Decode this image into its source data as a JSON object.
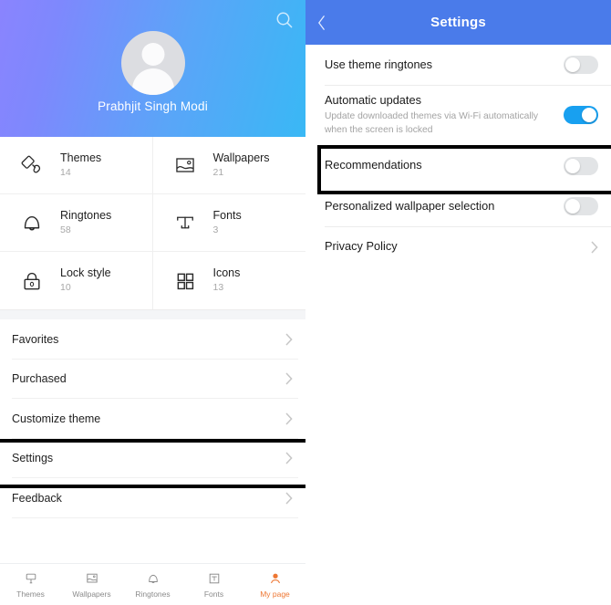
{
  "left": {
    "profile": {
      "name": "Prabhjit Singh Modi",
      "search_icon": "search-icon",
      "avatar_icon": "person-avatar-icon",
      "gradient_from": "#8a84fe",
      "gradient_to": "#39b8f5"
    },
    "grid": [
      {
        "label": "Themes",
        "count": "14",
        "icon": "paint-brush-icon"
      },
      {
        "label": "Wallpapers",
        "count": "21",
        "icon": "image-icon"
      },
      {
        "label": "Ringtones",
        "count": "58",
        "icon": "bell-icon"
      },
      {
        "label": "Fonts",
        "count": "3",
        "icon": "font-t-icon"
      },
      {
        "label": "Lock style",
        "count": "10",
        "icon": "padlock-icon"
      },
      {
        "label": "Icons",
        "count": "13",
        "icon": "grid-squares-icon"
      }
    ],
    "rows": [
      {
        "label": "Favorites",
        "chevron": "chevron-right-icon",
        "highlighted": false
      },
      {
        "label": "Purchased",
        "chevron": "chevron-right-icon",
        "highlighted": false
      },
      {
        "label": "Customize theme",
        "chevron": "chevron-right-icon",
        "highlighted": false
      },
      {
        "label": "Settings",
        "chevron": "chevron-right-icon",
        "highlighted": true
      },
      {
        "label": "Feedback",
        "chevron": "chevron-right-icon",
        "highlighted": false
      }
    ],
    "nav": {
      "active_color": "#ee7733",
      "items": [
        {
          "label": "Themes",
          "icon": "paint-brush-icon",
          "active": false
        },
        {
          "label": "Wallpapers",
          "icon": "image-icon",
          "active": false
        },
        {
          "label": "Ringtones",
          "icon": "bell-icon",
          "active": false
        },
        {
          "label": "Fonts",
          "icon": "font-t-icon",
          "active": false
        },
        {
          "label": "My page",
          "icon": "person-avatar-icon",
          "active": true
        }
      ]
    }
  },
  "right": {
    "header": {
      "title": "Settings",
      "back_icon": "chevron-left-icon",
      "bg": "#4a7bea"
    },
    "rows": [
      {
        "title": "Use theme ringtones",
        "subtitle": "",
        "control": "toggle",
        "toggle_on": false,
        "highlighted": false
      },
      {
        "title": "Automatic updates",
        "subtitle": "Update downloaded themes via Wi-Fi automatically when the screen is locked",
        "control": "toggle",
        "toggle_on": true,
        "highlighted": false
      },
      {
        "title": "Recommendations",
        "subtitle": "",
        "control": "toggle",
        "toggle_on": false,
        "highlighted": true
      },
      {
        "title": "Personalized wallpaper selection",
        "subtitle": "",
        "control": "toggle",
        "toggle_on": false,
        "highlighted": false
      },
      {
        "title": "Privacy Policy",
        "subtitle": "",
        "control": "chevron",
        "chevron": "chevron-right-icon",
        "highlighted": false
      }
    ],
    "toggle_on_color": "#18a0f0",
    "toggle_off_color": "#e2e4e6"
  },
  "annotations": {
    "highlight_color": "#000000",
    "boxes": [
      "settings-row-highlight",
      "recommendations-row-highlight"
    ]
  }
}
